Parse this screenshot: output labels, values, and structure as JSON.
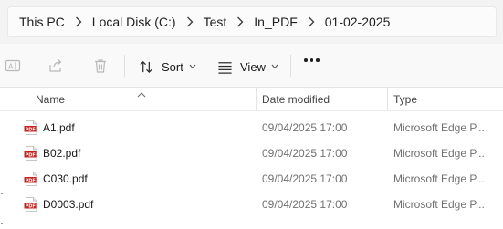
{
  "breadcrumb": {
    "items": [
      {
        "label": "This PC"
      },
      {
        "label": "Local Disk (C:)"
      },
      {
        "label": "Test"
      },
      {
        "label": "In_PDF"
      },
      {
        "label": "01-02-2025"
      }
    ]
  },
  "commandbar": {
    "rename_icon": "rename-icon",
    "share_icon": "share-icon",
    "delete_icon": "trash-icon",
    "sort_label": "Sort",
    "view_label": "View",
    "more_icon": "more-ellipsis-icon"
  },
  "columns": {
    "name": "Name",
    "date_modified": "Date modified",
    "type": "Type",
    "sort_indicator": "ascending"
  },
  "files": [
    {
      "name": "A1.pdf",
      "date": "09/04/2025 17:00",
      "type": "Microsoft Edge P...",
      "icon": "pdf-file-icon"
    },
    {
      "name": "B02.pdf",
      "date": "09/04/2025 17:00",
      "type": "Microsoft Edge P...",
      "icon": "pdf-file-icon"
    },
    {
      "name": "C030.pdf",
      "date": "09/04/2025 17:00",
      "type": "Microsoft Edge P...",
      "icon": "pdf-file-icon"
    },
    {
      "name": "D0003.pdf",
      "date": "09/04/2025 17:00",
      "type": "Microsoft Edge P...",
      "icon": "pdf-file-icon"
    }
  ],
  "colors": {
    "pdf_red": "#c8201c",
    "address_bg": "#f3f3f3",
    "secondary_text": "#707070"
  }
}
